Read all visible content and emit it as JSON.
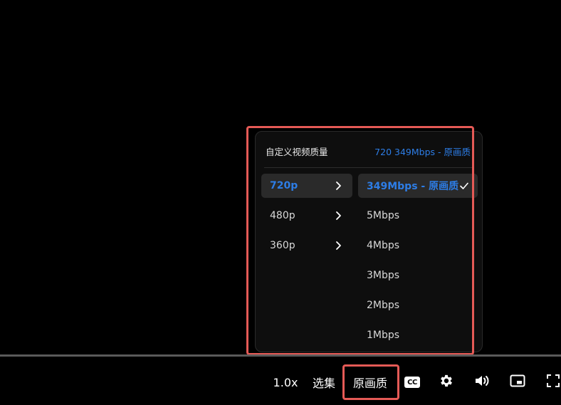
{
  "quality_menu": {
    "title": "自定义视频质量",
    "current": "720 349Mbps - 原画质",
    "resolutions": [
      {
        "label": "720p",
        "active": true
      },
      {
        "label": "480p",
        "active": false
      },
      {
        "label": "360p",
        "active": false
      }
    ],
    "bitrates": [
      {
        "label": "349Mbps - 原画质",
        "active": true
      },
      {
        "label": "5Mbps",
        "active": false
      },
      {
        "label": "4Mbps",
        "active": false
      },
      {
        "label": "3Mbps",
        "active": false
      },
      {
        "label": "2Mbps",
        "active": false
      },
      {
        "label": "1Mbps",
        "active": false
      }
    ]
  },
  "controls": {
    "speed": "1.0x",
    "episodes": "选集",
    "quality": "原画质",
    "cc_label": "CC",
    "icons": [
      "cc-icon",
      "gear-icon",
      "volume-icon",
      "pip-icon",
      "fullscreen-icon"
    ]
  },
  "colors": {
    "accent": "#2d7de6",
    "highlight": "#e55a56",
    "menu_bg": "#0e0e0e",
    "active_bg": "#2a2a2a"
  }
}
